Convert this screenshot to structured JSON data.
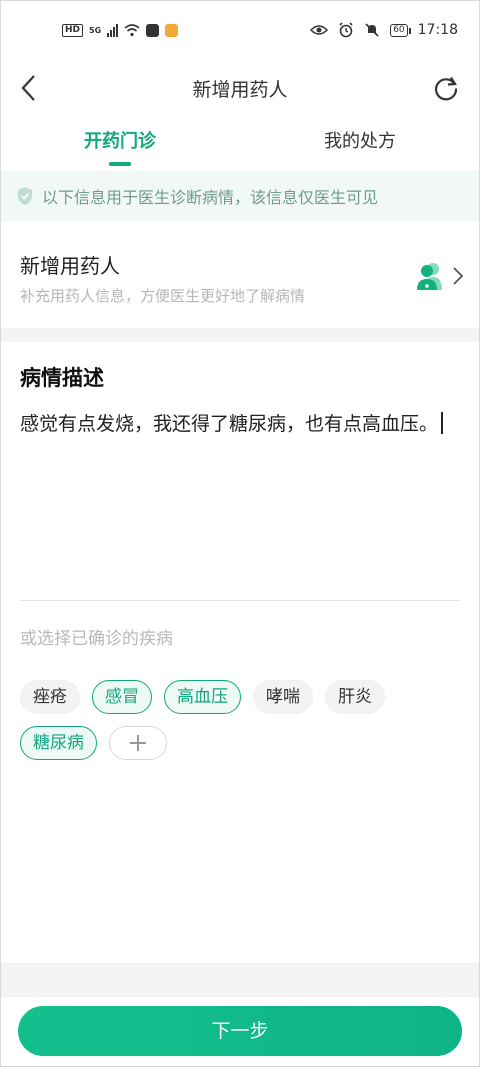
{
  "status_bar": {
    "hd": "HD",
    "signal_label": "5G",
    "time": "17:18",
    "battery": "60",
    "icons": [
      "eye-icon",
      "alarm-icon",
      "mute-icon",
      "battery-icon"
    ]
  },
  "nav": {
    "title": "新增用药人",
    "back_icon": "back-arrow-icon",
    "refresh_icon": "refresh-icon"
  },
  "tabs": [
    {
      "label": "开药门诊",
      "active": true
    },
    {
      "label": "我的处方",
      "active": false
    }
  ],
  "notice": {
    "icon": "shield-check-icon",
    "text": "以下信息用于医生诊断病情，该信息仅医生可见"
  },
  "patient": {
    "title": "新增用药人",
    "subtitle": "补充用药人信息，方便医生更好地了解病情",
    "icon": "add-patient-icon",
    "chevron": "chevron-right-icon"
  },
  "description": {
    "heading": "病情描述",
    "text": "感觉有点发烧，我还得了糖尿病，也有点高血压。"
  },
  "diseases": {
    "label": "或选择已确诊的疾病",
    "tags": [
      {
        "label": "痤疮",
        "selected": false
      },
      {
        "label": "感冒",
        "selected": true
      },
      {
        "label": "高血压",
        "selected": true
      },
      {
        "label": "哮喘",
        "selected": false
      },
      {
        "label": "肝炎",
        "selected": false
      },
      {
        "label": "糖尿病",
        "selected": true
      }
    ],
    "add_icon": "plus-icon"
  },
  "footer": {
    "next_label": "下一步"
  },
  "colors": {
    "accent": "#12a77c",
    "notice_bg": "#f2f8f6",
    "button": "#13c08d"
  }
}
